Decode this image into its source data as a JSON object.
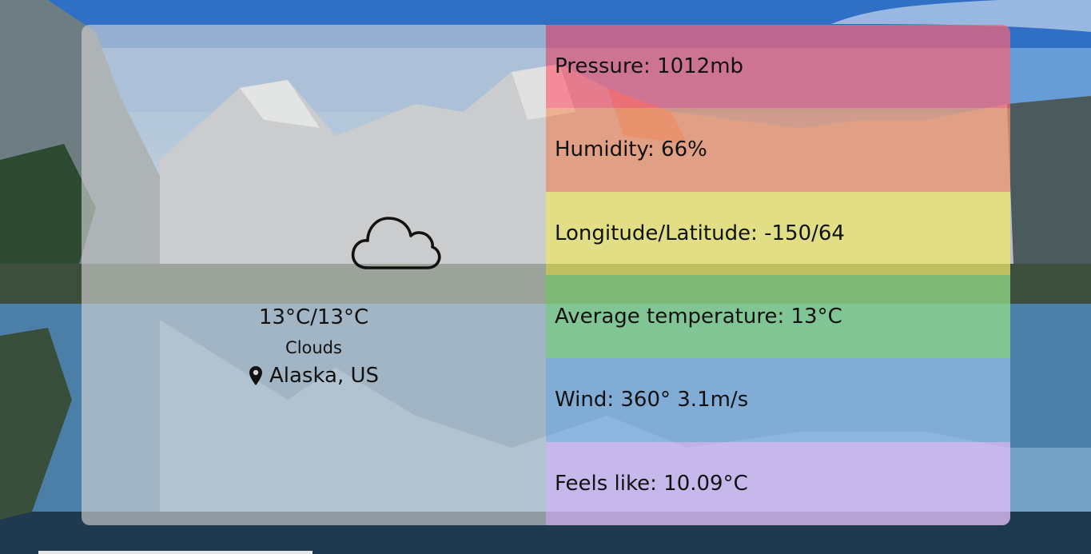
{
  "weather": {
    "icon": "cloud-icon",
    "temperature_range": "13°C/13°C",
    "description": "Clouds",
    "location_icon": "map-pin-icon",
    "location": "Alaska, US"
  },
  "stats": [
    {
      "text": "Pressure: 1012mb",
      "color": "#f56478"
    },
    {
      "text": "Humidity: 66%",
      "color": "#f0966e"
    },
    {
      "text": "Longitude/Latitude: -150/64",
      "color": "#f0eb6e"
    },
    {
      "text": "Average temperature: 13°C",
      "color": "#96e18c"
    },
    {
      "text": "Wind: 360° 3.1m/s",
      "color": "#96bee6"
    },
    {
      "text": "Feels like: 10.09°C",
      "color": "#dcbef5"
    }
  ]
}
